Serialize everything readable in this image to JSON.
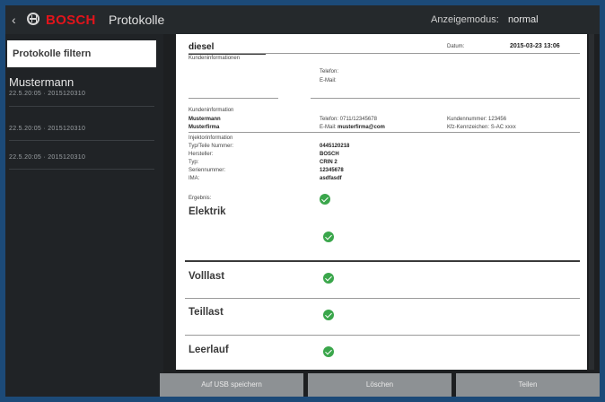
{
  "topbar": {
    "back": "‹",
    "logo": "BOSCH",
    "title": "Protokolle",
    "mode_label": "Anzeigemodus:",
    "mode_value": "normal"
  },
  "sidebar": {
    "filter_label": "Protokolle filtern",
    "entries": [
      {
        "name": "Mustermann",
        "date": "22.5.20:05 · 2015120310"
      },
      {
        "name": "",
        "date": "22.5.20:05 · 2015120310"
      },
      {
        "name": "",
        "date": "22.5.20:05 · 2015120310"
      }
    ]
  },
  "protocol": {
    "title": "diesel",
    "date_label": "Datum:",
    "date_value": "2015-03-23 13:06",
    "kunden_header": "Kundeninformationen",
    "telefon_label": "Telefon:",
    "email_label": "E-Mail:",
    "kunde_header": "Kundeninformation",
    "kunde_name": "Mustermann",
    "kunde_firma": "Musterfirma",
    "telefon_full": "Telefon: 0711/12345678",
    "email_full_label": "E-Mail:",
    "email_full_value": "musterfirma@com",
    "kunden_nr": "Kundennummer: 123456",
    "kfz": "Kfz-Kennzeichen: S-AC xxxx",
    "injektor_header": "Injektorinformation",
    "typ_teile_label": "Typ/Teile Nummer:",
    "typ_teile_value": "0445120218",
    "hersteller_label": "Hersteller:",
    "hersteller_value": "BOSCH",
    "typ_label": "Typ:",
    "typ_value": "CRIN 2",
    "serien_label": "Seriennummer:",
    "serien_value": "12345678",
    "ima_label": "IMA:",
    "ima_value": "asdfasdf",
    "ergebnis_label": "Ergebnis:",
    "sections": [
      "Elektrik",
      "Volllast",
      "Teillast",
      "Leerlauf"
    ]
  },
  "bottom": {
    "save_usb": "Auf USB speichern",
    "delete": "Löschen",
    "third": "Teilen"
  },
  "colors": {
    "logo_red": "#e2141b",
    "check_green": "#3aa64b",
    "frame_blue": "#1c4a78"
  }
}
